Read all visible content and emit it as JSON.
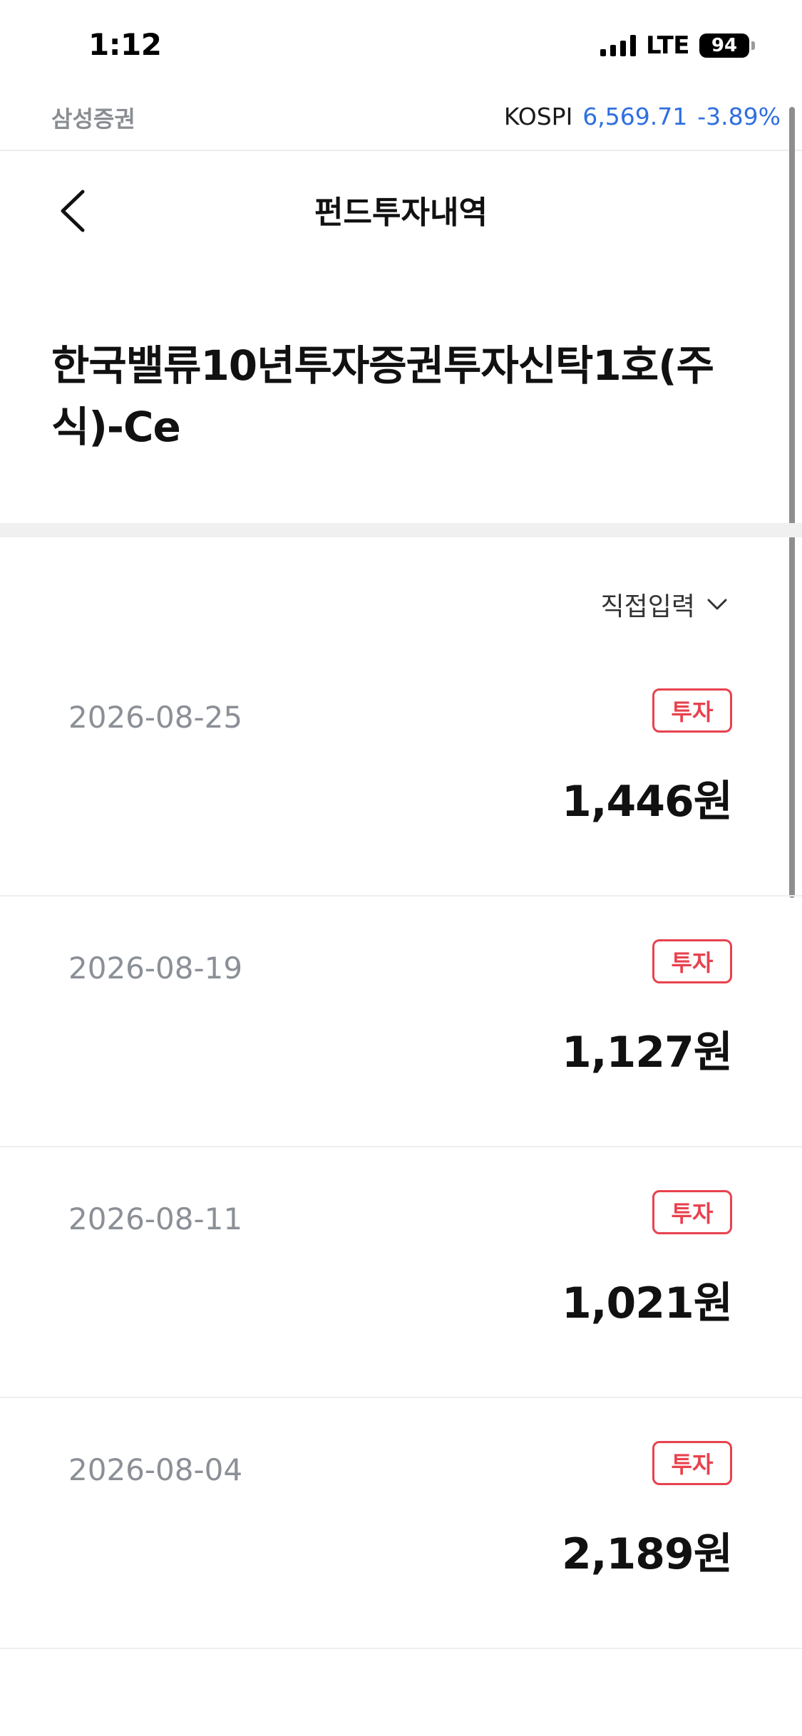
{
  "status_bar": {
    "time": "1:12",
    "network": "LTE",
    "battery": "94"
  },
  "broker": {
    "name": "삼성증권"
  },
  "market_index": {
    "name": "KOSPI",
    "value": "6,569.71",
    "change": "-3.89%"
  },
  "nav": {
    "title": "펀드투자내역"
  },
  "fund": {
    "name": "한국밸류10년투자증권투자신탁1호(주식)-Ce"
  },
  "filter": {
    "label": "직접입력"
  },
  "records": [
    {
      "date": "2026-08-25",
      "type": "투자",
      "amount": "1,446원"
    },
    {
      "date": "2026-08-19",
      "type": "투자",
      "amount": "1,127원"
    },
    {
      "date": "2026-08-11",
      "type": "투자",
      "amount": "1,021원"
    },
    {
      "date": "2026-08-04",
      "type": "투자",
      "amount": "2,189원"
    }
  ]
}
